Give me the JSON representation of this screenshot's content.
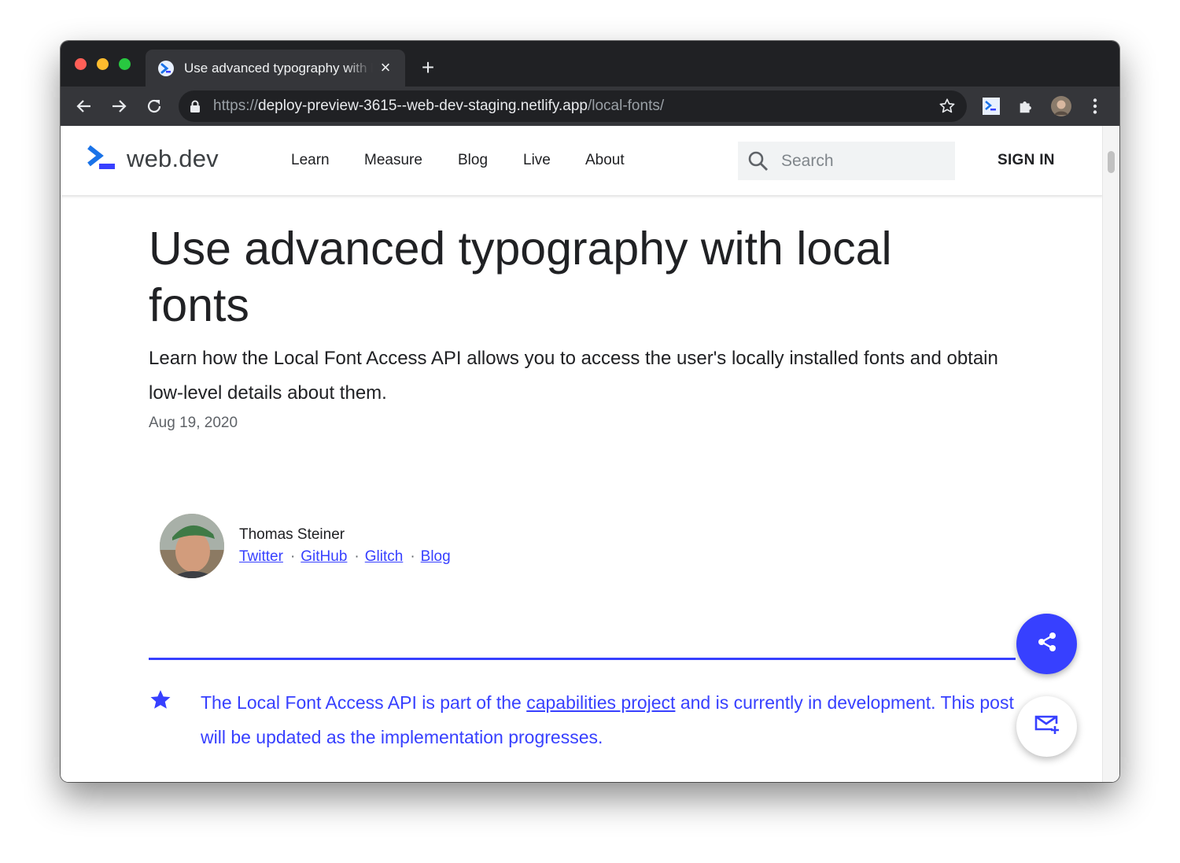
{
  "browser": {
    "tab": {
      "title": "Use advanced typography with local fonts",
      "close_glyph": "×"
    },
    "new_tab_glyph": "+",
    "address_bar": {
      "scheme": "https://",
      "host": "deploy-preview-3615--web-dev-staging.netlify.app",
      "path": "/local-fonts/"
    },
    "icons": [
      "back-arrow-icon",
      "forward-arrow-icon",
      "reload-icon",
      "lock-icon",
      "bookmark-star-icon",
      "webdev-extension-icon",
      "extensions-puzzle-icon",
      "profile-avatar-icon",
      "more-vertical-icon"
    ]
  },
  "site": {
    "logo_text": "web.dev",
    "nav": [
      "Learn",
      "Measure",
      "Blog",
      "Live",
      "About"
    ],
    "search_placeholder": "Search",
    "sign_in": "SIGN IN",
    "brand_color": "#3740ff"
  },
  "article": {
    "title": "Use advanced typography with local fonts",
    "subtitle": "Learn how the Local Font Access API allows you to access the user's locally installed fonts and obtain low-level details about them.",
    "date": "Aug 19, 2020",
    "author": {
      "name": "Thomas Steiner",
      "links": [
        "Twitter",
        "GitHub",
        "Glitch",
        "Blog"
      ]
    },
    "callout": {
      "text_before": "The Local Font Access API is part of the ",
      "link": "capabilities project",
      "text_after": " and is currently in development. This post will be updated as the implementation progresses."
    }
  },
  "fabs": [
    "share-icon",
    "subscribe-mail-icon"
  ]
}
